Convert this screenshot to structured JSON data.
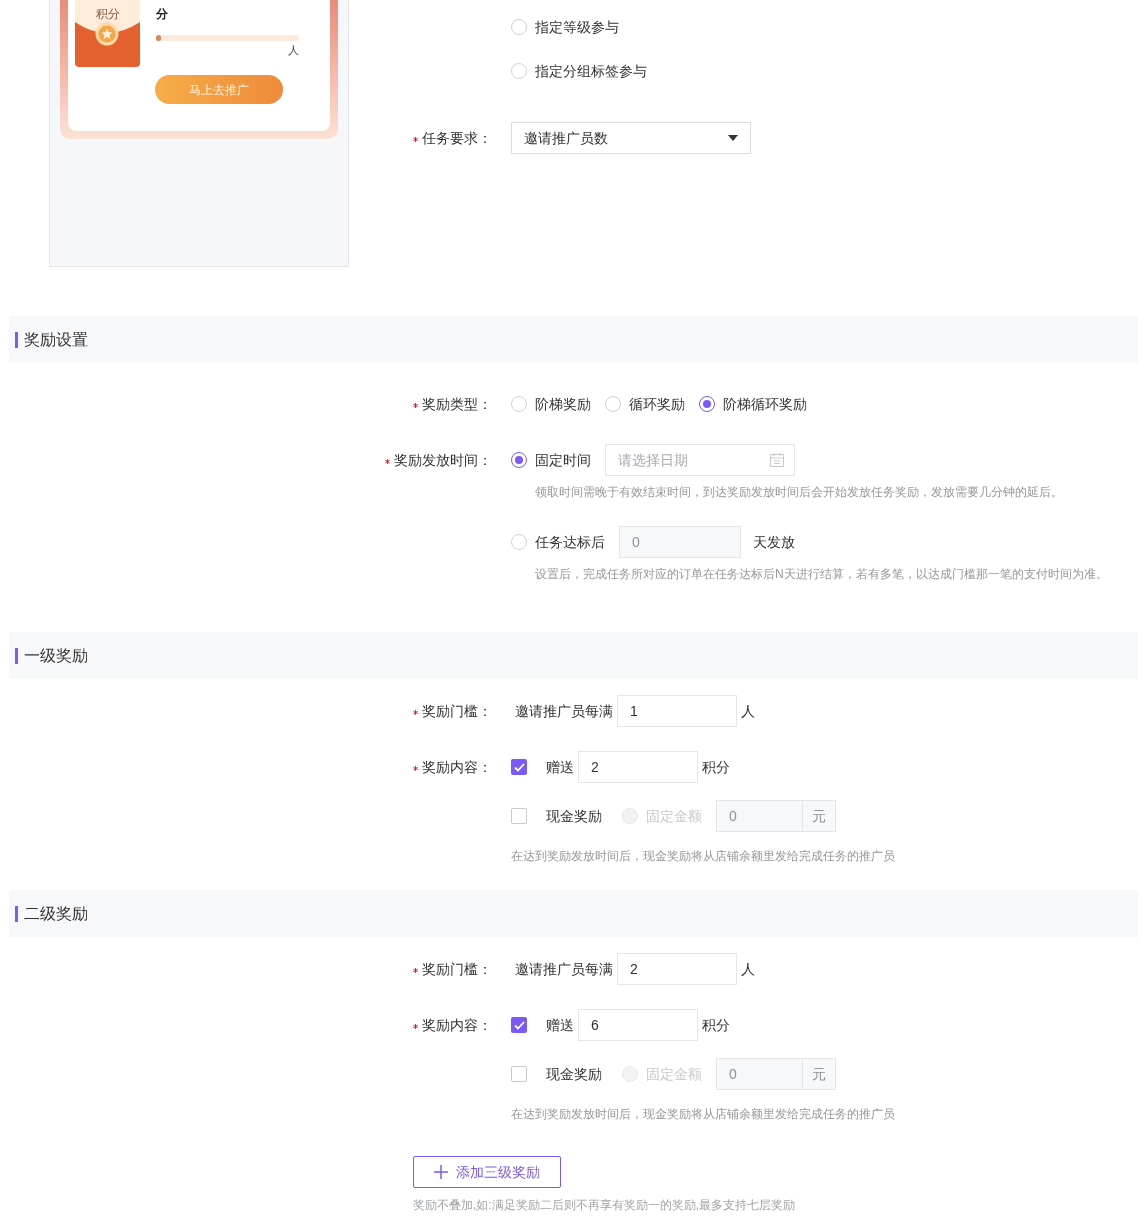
{
  "preview": {
    "envelope_text": "积分",
    "points_unit": "分",
    "progress": {
      "level": 0.02
    },
    "people_unit": "人",
    "button": "马上去推广"
  },
  "participation": [
    {
      "label": "指定等级参与",
      "selected": false
    },
    {
      "label": "指定分组标签参与",
      "selected": false
    }
  ],
  "task_requirement": {
    "label": "任务要求：",
    "required": true,
    "value": "邀请推广员数"
  },
  "reward_settings": {
    "title": "奖励设置",
    "reward_type": {
      "label": "奖励类型：",
      "required": true,
      "options": [
        {
          "label": "阶梯奖励",
          "selected": false
        },
        {
          "label": "循环奖励",
          "selected": false
        },
        {
          "label": "阶梯循环奖励",
          "selected": true
        }
      ]
    },
    "issue_time": {
      "label": "奖励发放时间：",
      "required": true,
      "options": [
        {
          "kind": "date",
          "label": "固定时间",
          "selected": true,
          "placeholder": "请选择日期",
          "hint": "领取时间需晚于有效结束时间，到达奖励发放时间后会开始发放任务奖励，发放需要几分钟的延后。"
        },
        {
          "kind": "days",
          "label": "任务达标后",
          "selected": false,
          "value": "0",
          "suffix": "天发放",
          "hint": "设置后，完成任务所对应的订单在任务达标后N天进行结算，若有多笔，以达成门槛那一笔的支付时间为准。"
        }
      ]
    }
  },
  "levels": [
    {
      "title": "一级奖励",
      "threshold": {
        "label": "奖励门槛：",
        "required": true,
        "prefix": "邀请推广员每满",
        "value": "1",
        "suffix": "人"
      },
      "content": {
        "label": "奖励内容：",
        "required": true,
        "points": {
          "checked": true,
          "prefix": "赠送",
          "value": "2",
          "suffix": "积分"
        },
        "cash": {
          "checked": false,
          "label": "现金奖励",
          "mode": {
            "label": "固定金额",
            "selected": false
          },
          "value": "0",
          "unit": "元"
        },
        "hint": "在达到奖励发放时间后，现金奖励将从店铺余额里发给完成任务的推广员"
      }
    },
    {
      "title": "二级奖励",
      "threshold": {
        "label": "奖励门槛：",
        "required": true,
        "prefix": "邀请推广员每满",
        "value": "2",
        "suffix": "人"
      },
      "content": {
        "label": "奖励内容：",
        "required": true,
        "points": {
          "checked": true,
          "prefix": "赠送",
          "value": "6",
          "suffix": "积分"
        },
        "cash": {
          "checked": false,
          "label": "现金奖励",
          "mode": {
            "label": "固定金额",
            "selected": false
          },
          "value": "0",
          "unit": "元"
        },
        "hint": "在达到奖励发放时间后，现金奖励将从店铺余额里发给完成任务的推广员"
      }
    }
  ],
  "add_button": "添加三级奖励",
  "note": "奖励不叠加,如:满足奖励二后则不再享有奖励一的奖励,最多支持七层奖励"
}
